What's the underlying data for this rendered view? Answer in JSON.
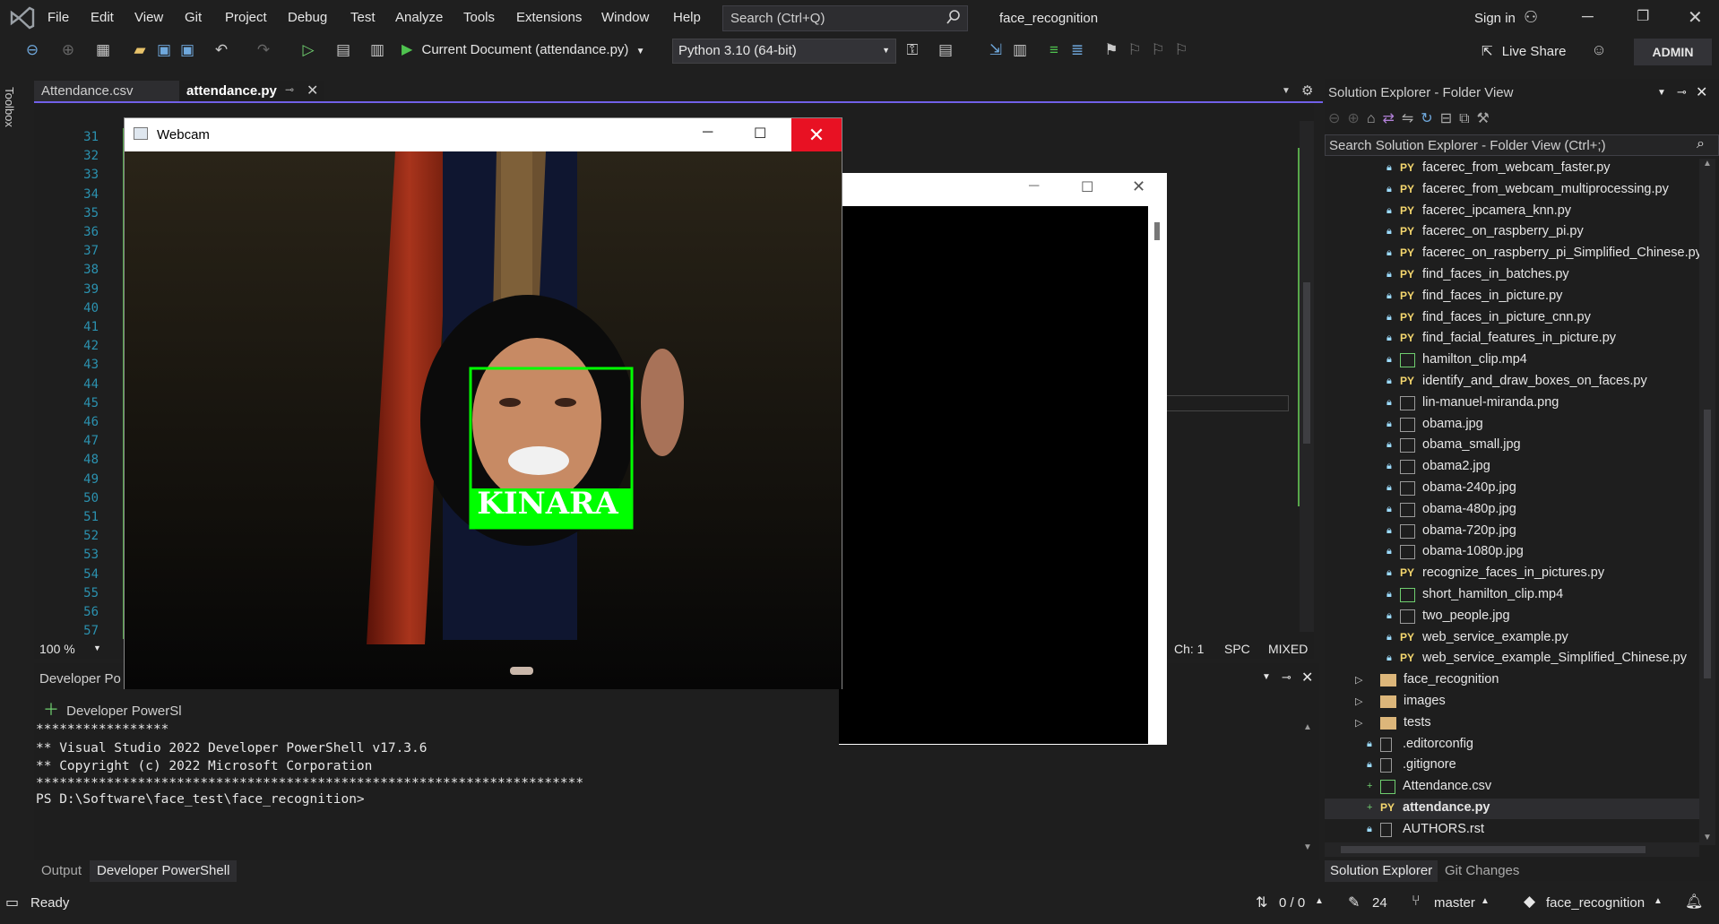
{
  "menu": [
    "File",
    "Edit",
    "View",
    "Git",
    "Project",
    "Debug",
    "Test",
    "Analyze",
    "Tools",
    "Extensions",
    "Window",
    "Help"
  ],
  "search": {
    "placeholder": "Search (Ctrl+Q)"
  },
  "window_title": "face_recognition",
  "sign_in": "Sign in",
  "toolbar": {
    "run_label": "Current Document (attendance.py)",
    "env": "Python 3.10 (64-bit)",
    "live_share": "Live Share",
    "admin": "ADMIN"
  },
  "side_tab": "Toolbox",
  "tabs": [
    {
      "label": "Attendance.csv"
    },
    {
      "label": "attendance.py"
    }
  ],
  "line_numbers": [
    "31",
    "32",
    "33",
    "34",
    "35",
    "36",
    "37",
    "38",
    "39",
    "40",
    "41",
    "42",
    "43",
    "44",
    "45",
    "46",
    "47",
    "48",
    "49",
    "50",
    "51",
    "52",
    "53",
    "54",
    "55",
    "56",
    "57"
  ],
  "editor_status": {
    "zoom": "100 %",
    "ch": "Ch: 1",
    "spc": "SPC",
    "mixed": "MIXED"
  },
  "webcam": {
    "title": "Webcam",
    "face_label": "KINARA"
  },
  "panel": {
    "title": "Developer Po",
    "new_tab": "Developer PowerSl",
    "lines": [
      "*****************",
      "** Visual Studio 2022 Developer PowerShell v17.3.6",
      "** Copyright (c) 2022 Microsoft Corporation",
      "**********************************************************************",
      "PS D:\\Software\\face_test\\face_recognition>"
    ],
    "tabs": [
      "Output",
      "Developer PowerShell"
    ]
  },
  "solution_explorer": {
    "title": "Solution Explorer - Folder View",
    "search_placeholder": "Search Solution Explorer - Folder View (Ctrl+;)",
    "files": [
      {
        "name": "facerec_from_webcam_faster.py",
        "kind": "py"
      },
      {
        "name": "facerec_from_webcam_multiprocessing.py",
        "kind": "py"
      },
      {
        "name": "facerec_ipcamera_knn.py",
        "kind": "py"
      },
      {
        "name": "facerec_on_raspberry_pi.py",
        "kind": "py"
      },
      {
        "name": "facerec_on_raspberry_pi_Simplified_Chinese.py",
        "kind": "py"
      },
      {
        "name": "find_faces_in_batches.py",
        "kind": "py"
      },
      {
        "name": "find_faces_in_picture.py",
        "kind": "py"
      },
      {
        "name": "find_faces_in_picture_cnn.py",
        "kind": "py"
      },
      {
        "name": "find_facial_features_in_picture.py",
        "kind": "py"
      },
      {
        "name": "hamilton_clip.mp4",
        "kind": "video"
      },
      {
        "name": "identify_and_draw_boxes_on_faces.py",
        "kind": "py"
      },
      {
        "name": "lin-manuel-miranda.png",
        "kind": "img"
      },
      {
        "name": "obama.jpg",
        "kind": "img"
      },
      {
        "name": "obama_small.jpg",
        "kind": "img"
      },
      {
        "name": "obama2.jpg",
        "kind": "img"
      },
      {
        "name": "obama-240p.jpg",
        "kind": "img"
      },
      {
        "name": "obama-480p.jpg",
        "kind": "img"
      },
      {
        "name": "obama-720p.jpg",
        "kind": "img"
      },
      {
        "name": "obama-1080p.jpg",
        "kind": "img"
      },
      {
        "name": "recognize_faces_in_pictures.py",
        "kind": "py"
      },
      {
        "name": "short_hamilton_clip.mp4",
        "kind": "video"
      },
      {
        "name": "two_people.jpg",
        "kind": "img"
      },
      {
        "name": "web_service_example.py",
        "kind": "py"
      },
      {
        "name": "web_service_example_Simplified_Chinese.py",
        "kind": "py"
      }
    ],
    "folders": [
      "face_recognition",
      "images",
      "tests"
    ],
    "root_files": [
      {
        "name": ".editorconfig",
        "kind": "doc"
      },
      {
        "name": ".gitignore",
        "kind": "doc"
      },
      {
        "name": "Attendance.csv",
        "kind": "csv"
      },
      {
        "name": "attendance.py",
        "kind": "py",
        "selected": true
      },
      {
        "name": "AUTHORS.rst",
        "kind": "doc"
      }
    ],
    "bottom_tabs": [
      "Solution Explorer",
      "Git Changes"
    ]
  },
  "statusbar": {
    "ready": "Ready",
    "arrows": "0 / 0",
    "edits": "24",
    "branch": "master",
    "repo": "face_recognition"
  }
}
